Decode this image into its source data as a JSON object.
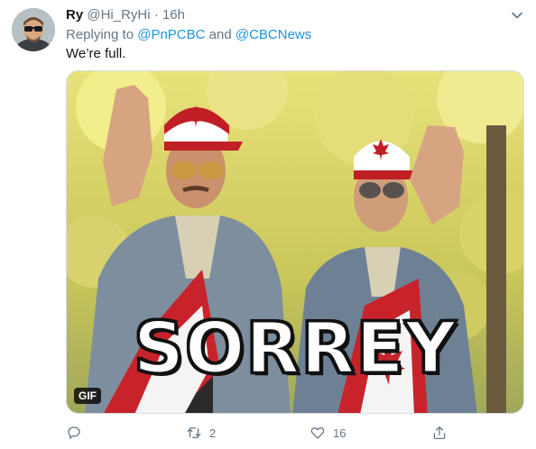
{
  "tweet": {
    "display_name": "Ry",
    "handle": "@Hi_RyHi",
    "separator": "·",
    "time": "16h",
    "reply_prefix": "Replying to",
    "reply_mentions": [
      "@PnPCBC",
      "@CBCNews"
    ],
    "reply_joiner": "and",
    "text": "We’re full.",
    "media": {
      "badge": "GIF",
      "caption": "SORREY"
    },
    "actions": {
      "reply_count": "",
      "retweet_count": "2",
      "like_count": "16"
    }
  },
  "colors": {
    "link": "#1b95e0",
    "secondary_text": "#657786",
    "primary_text": "#14171a"
  },
  "icons": [
    "caret-down-icon",
    "reply-icon",
    "retweet-icon",
    "like-icon",
    "share-icon"
  ]
}
